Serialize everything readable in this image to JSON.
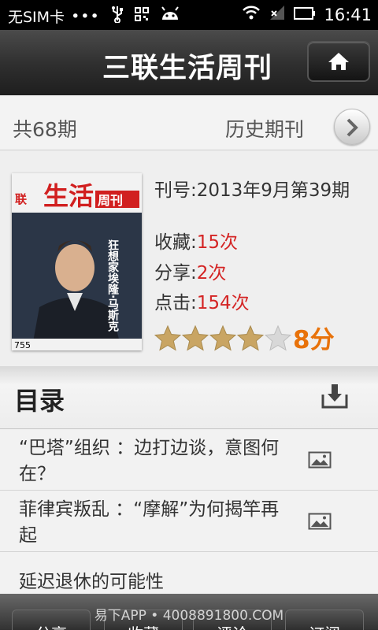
{
  "status_bar": {
    "carrier": "无SIM卡",
    "dots": "•••",
    "time": "16:41"
  },
  "header": {
    "title": "三联生活周刊",
    "home_icon": "home-icon"
  },
  "issues": {
    "count": "共68期",
    "history_label": "历史期刊"
  },
  "magazine": {
    "issue_label": "刊号:",
    "issue_value": "2013年9月第39期",
    "favorites_label": "收藏:",
    "favorites_value": "15次",
    "shares_label": "分享:",
    "shares_value": "2次",
    "clicks_label": "点击:",
    "clicks_value": "154次",
    "rating_stars": 4,
    "rating_max": 5,
    "score": "8分",
    "cover": {
      "masthead_left": "联",
      "masthead_main": "生活",
      "masthead_right": "周刊",
      "headline": "狂想家埃隆·马斯克",
      "issue_number": "755"
    }
  },
  "catalog": {
    "title": "目录",
    "items": [
      {
        "text": "“巴塔”组织 ：边打边谈，意图何在？"
      },
      {
        "text": "菲律宾叛乱 ：“摩解”为何揭竿再起"
      },
      {
        "text": "延迟退休的可能性"
      }
    ]
  },
  "bottom_bar": {
    "watermark": "易下APP • 4008891800.COM",
    "buttons": [
      "分享",
      "收藏",
      "评论",
      "订阅"
    ]
  },
  "colors": {
    "accent_red": "#d42424",
    "score_orange": "#e8720a",
    "star_gold": "#c9a563"
  }
}
